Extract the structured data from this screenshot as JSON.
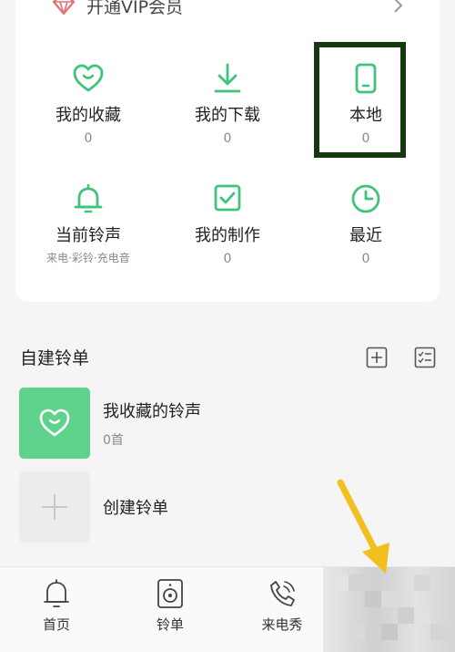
{
  "vip": {
    "label": "开通VIP会员"
  },
  "grid": [
    {
      "label": "我的收藏",
      "count": "0",
      "icon": "heart-smile-icon"
    },
    {
      "label": "我的下载",
      "count": "0",
      "icon": "download-icon"
    },
    {
      "label": "本地",
      "count": "0",
      "icon": "phone-icon"
    },
    {
      "label": "当前铃声",
      "sub": "来电·彩铃·充电音",
      "icon": "bell-icon"
    },
    {
      "label": "我的制作",
      "count": "0",
      "icon": "checkbox-icon"
    },
    {
      "label": "最近",
      "count": "0",
      "icon": "clock-icon"
    }
  ],
  "section": {
    "title": "自建铃单"
  },
  "playlists": [
    {
      "title": "我收藏的铃声",
      "count": "0首"
    },
    {
      "title": "创建铃单"
    }
  ],
  "nav": [
    {
      "label": "首页",
      "icon": "bell-home-icon"
    },
    {
      "label": "铃单",
      "icon": "speaker-icon"
    },
    {
      "label": "来电秀",
      "icon": "phone-call-icon"
    }
  ],
  "colors": {
    "accent": "#3fc47a",
    "highlight_border": "#14390f",
    "annotation_arrow": "#f2bf21"
  }
}
